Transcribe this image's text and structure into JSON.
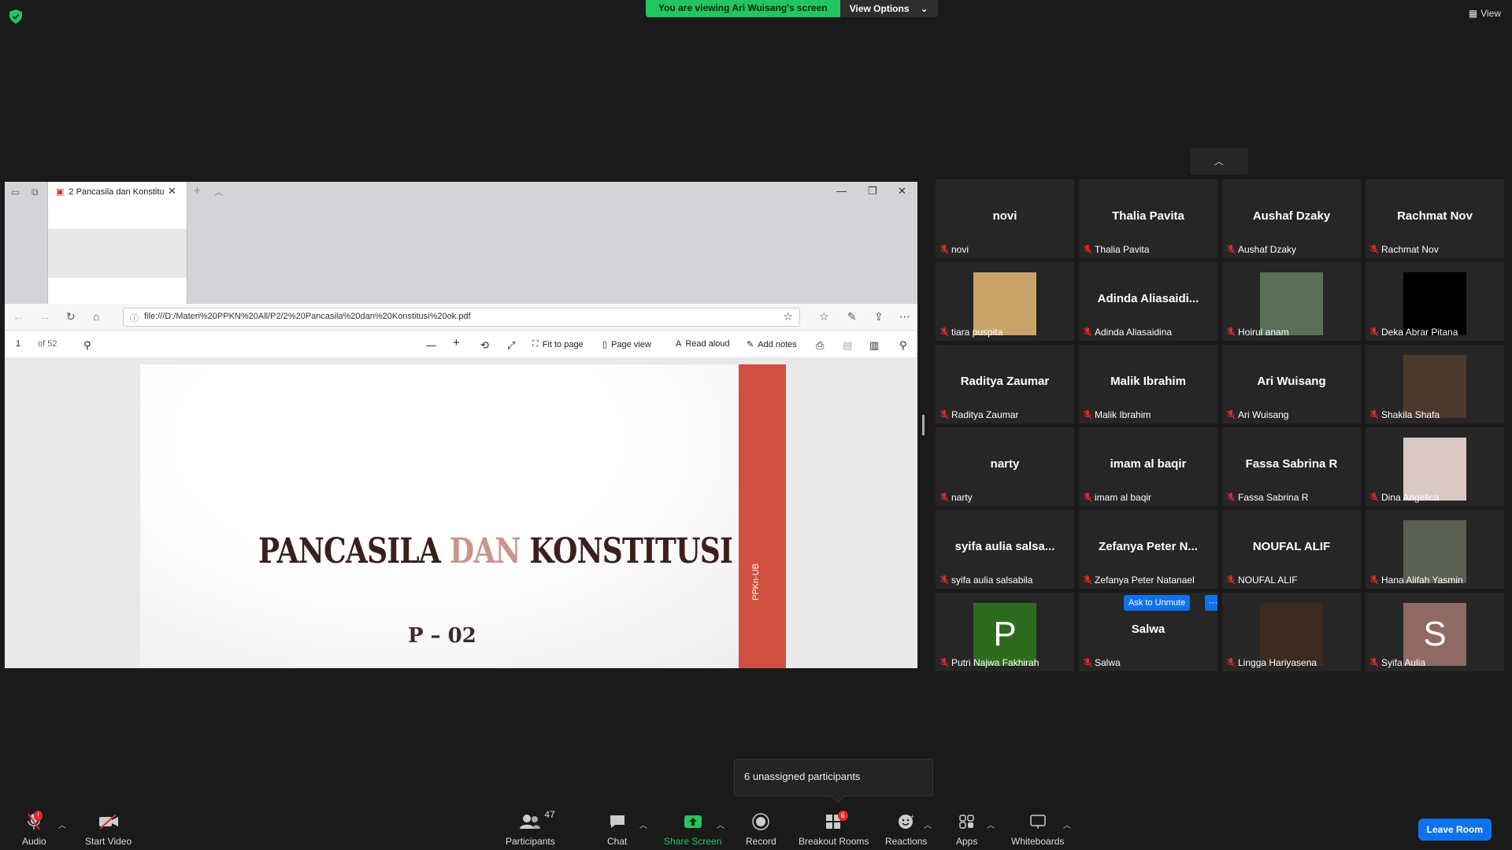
{
  "banner": {
    "viewing_text": "You are viewing Ari Wuisang's screen",
    "view_options_label": "View Options"
  },
  "view_label": "View",
  "browser": {
    "tab_title": "2 Pancasila dan Konstitu",
    "url": "file:///D:/Materi%20PPKN%20All/P2/2%20Pancasila%20dan%20Konstitusi%20ok.pdf",
    "pdf_toolbar": {
      "page_number": "1",
      "page_count": "of 52",
      "fit_to_page": "Fit to page",
      "page_view": "Page view",
      "read_aloud": "Read aloud",
      "add_notes": "Add notes"
    }
  },
  "slide": {
    "title_part1": "PANCASILA ",
    "title_part2": "DAN",
    "title_part3": " KONSTITUSI",
    "subtitle": "P – 02",
    "side_label": "PPKn-UB"
  },
  "participants": [
    {
      "display": "novi",
      "name": "novi",
      "type": "name"
    },
    {
      "display": "Thalia Pavita",
      "name": "Thalia Pavita",
      "type": "name"
    },
    {
      "display": "Aushaf Dzaky",
      "name": "Aushaf Dzaky",
      "type": "name"
    },
    {
      "display": "Rachmat Nov",
      "name": "Rachmat Nov",
      "type": "name"
    },
    {
      "display": "",
      "name": "tiara puspita",
      "type": "photo",
      "color": "#c8a36a"
    },
    {
      "display": "Adinda  Aliasaidi...",
      "name": "Adinda Aliasaidina",
      "type": "name"
    },
    {
      "display": "",
      "name": "Hoirul anam",
      "type": "photo",
      "color": "#5a6e5a"
    },
    {
      "display": "",
      "name": "Deka Abrar Pitana",
      "type": "photo",
      "color": "#000000"
    },
    {
      "display": "Raditya Zaumar",
      "name": "Raditya Zaumar",
      "type": "name"
    },
    {
      "display": "Malik Ibrahim",
      "name": "Malik Ibrahim",
      "type": "name"
    },
    {
      "display": "Ari Wuisang",
      "name": "Ari Wuisang",
      "type": "name"
    },
    {
      "display": "",
      "name": "Shakila Shafa",
      "type": "photo",
      "color": "#4a3a2c"
    },
    {
      "display": "narty",
      "name": "narty",
      "type": "name"
    },
    {
      "display": "imam al baqir",
      "name": "imam al baqir",
      "type": "name"
    },
    {
      "display": "Fassa Sabrina R",
      "name": "Fassa Sabrina R",
      "type": "name"
    },
    {
      "display": "",
      "name": "Dina Angelica",
      "type": "photo",
      "color": "#d9c9c2"
    },
    {
      "display": "syifa aulia salsa...",
      "name": "syifa aulia salsabila",
      "type": "name"
    },
    {
      "display": "Zefanya Peter N...",
      "name": "Zefanya Peter Natanael",
      "type": "name"
    },
    {
      "display": "NOUFAL ALIF",
      "name": "NOUFAL ALIF",
      "type": "name"
    },
    {
      "display": "",
      "name": "Hana Alifah Yasmin",
      "type": "photo",
      "color": "#5a5f52"
    },
    {
      "display": "P",
      "name": "Putri Najwa Fakhirah",
      "type": "letter",
      "color": "#2e6b1e"
    },
    {
      "display": "Salwa",
      "name": "Salwa",
      "type": "name",
      "ask_to_unmute": "Ask to Unmute",
      "more": "···"
    },
    {
      "display": "",
      "name": "Lingga Hariyasena",
      "type": "photo",
      "color": "#3d2a22"
    },
    {
      "display": "S",
      "name": "Syifa Aulia",
      "type": "letter",
      "color": "#8f6a63"
    }
  ],
  "unassigned_tooltip": "6 unassigned participants",
  "toolbar": {
    "audio": "Audio",
    "audio_badge": "!",
    "start_video": "Start Video",
    "participants": "Participants",
    "participants_count": "47",
    "chat": "Chat",
    "share_screen": "Share Screen",
    "record": "Record",
    "breakout_rooms": "Breakout Rooms",
    "breakout_badge": "6",
    "reactions": "Reactions",
    "apps": "Apps",
    "whiteboards": "Whiteboards",
    "leave_room": "Leave Room"
  },
  "colors": {
    "accent_green": "#22c55e",
    "accent_blue": "#0e72ed",
    "mute_red": "#e02828",
    "slide_red": "#cf5040"
  }
}
